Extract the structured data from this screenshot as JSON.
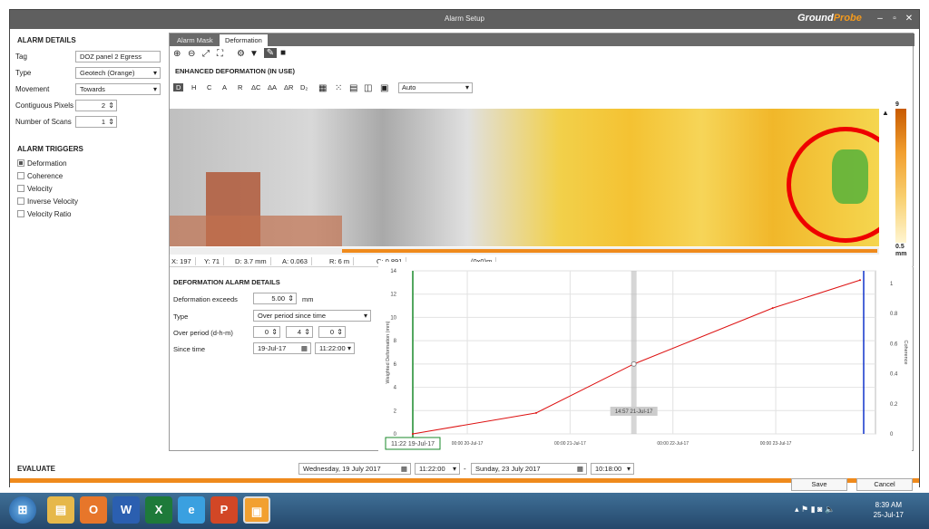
{
  "window": {
    "title": "Alarm Setup",
    "logo_a": "Ground",
    "logo_b": "Probe"
  },
  "left": {
    "alarm_details_title": "ALARM DETAILS",
    "tag_label": "Tag",
    "tag_value": "DOZ panel 2 Egress",
    "type_label": "Type",
    "type_value": "Geotech (Orange)",
    "movement_label": "Movement",
    "movement_value": "Towards",
    "pixels_label": "Contiguous Pixels",
    "pixels_value": "2",
    "scans_label": "Number of Scans",
    "scans_value": "1",
    "triggers_title": "ALARM TRIGGERS",
    "triggers": [
      {
        "label": "Deformation",
        "checked": true
      },
      {
        "label": "Coherence",
        "checked": false
      },
      {
        "label": "Velocity",
        "checked": false
      },
      {
        "label": "Inverse Velocity",
        "checked": false
      },
      {
        "label": "Velocity Ratio",
        "checked": false
      }
    ]
  },
  "tabs": [
    "Alarm Mask",
    "Deformation"
  ],
  "subtitle": "ENHANCED DEFORMATION  (IN USE)",
  "mode_buttons": [
    "D",
    "H",
    "C",
    "A",
    "R",
    "ΔC",
    "ΔA",
    "ΔR",
    "D₂"
  ],
  "view_select": "Auto",
  "scale": {
    "max": "9",
    "min": "0.5",
    "unit": "mm"
  },
  "status": {
    "x": "X: 197",
    "y": "Y: 71",
    "d": "D: 3.7 mm",
    "a": "A: 0.063",
    "r": "R: 6 m",
    "c": "C: 0.891",
    "coord": "(0x0)m"
  },
  "details": {
    "title": "DEFORMATION ALARM DETAILS",
    "exceeds_label": "Deformation exceeds",
    "exceeds_value": "5.00",
    "exceeds_unit": "mm",
    "type_label": "Type",
    "type_value": "Over period since time",
    "period_label": "Over period (d-h-m)",
    "period_d": "0",
    "period_h": "4",
    "period_m": "0",
    "since_label": "Since time",
    "since_date": "19-Jul-17",
    "since_time": "11:22:00"
  },
  "chart_data": {
    "type": "line",
    "ylabel": "Weighted Deformation (mm)",
    "y2label": "Coherence",
    "xlabel": "Time",
    "y_ticks": [
      "0",
      "2",
      "4",
      "6",
      "8",
      "10",
      "12",
      "14"
    ],
    "y2_ticks": [
      "0",
      "0.2",
      "0.4",
      "0.6",
      "0.8",
      "1"
    ],
    "x_ticks": [
      "00:00 20-Jul-17",
      "00:00 21-Jul-17",
      "00:00 22-Jul-17",
      "00:00 23-Jul-17"
    ],
    "ylim": [
      0,
      14
    ],
    "start_marker": "11:22 19-Jul-17",
    "cursor_marker": "14:57 21-Jul-17",
    "series": [
      {
        "name": "Enhanced Deformation",
        "color": "#d11",
        "x_days": [
          0,
          1.2,
          2.15,
          3.5,
          4.35
        ],
        "y": [
          0,
          1.8,
          6,
          10.8,
          13.2
        ]
      },
      {
        "name": "Coherence",
        "color": "#11c",
        "y": []
      }
    ]
  },
  "evaluate": {
    "label": "EVALUATE",
    "start_date": "Wednesday, 19 July 2017",
    "start_time": "11:22:00",
    "sep": "-",
    "end_date": "Sunday, 23 July 2017",
    "end_time": "10:18:00"
  },
  "buttons": {
    "save": "Save",
    "cancel": "Cancel"
  },
  "taskbar": {
    "time": "8:39 AM",
    "date": "25-Jul-17"
  }
}
